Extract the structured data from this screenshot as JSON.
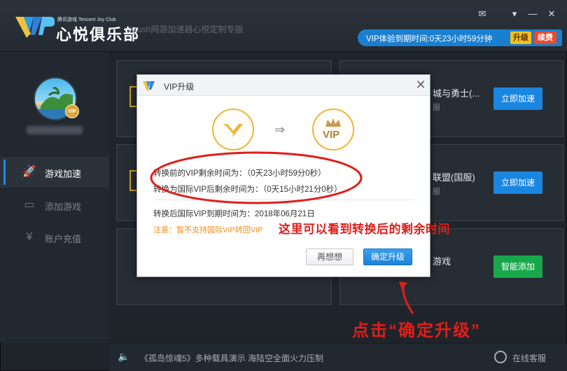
{
  "window": {
    "brand_small": "腾讯游戏 Tencent Joy Club",
    "brand_main": "心悦俱乐部",
    "subtitle": "Xrush网游加速器心悦定制专版",
    "controls": [
      "mail-icon",
      "menu-icon",
      "minimize-icon",
      "close-icon"
    ]
  },
  "vip_bar": {
    "text": "VIP体验到期时间:0天23小时59分钟",
    "upgrade": "升级",
    "renew": "续费"
  },
  "sidebar": {
    "items": [
      {
        "label": "游戏加速",
        "icon": "rocket-icon",
        "active": true
      },
      {
        "label": "添加游戏",
        "icon": "gamepad-icon",
        "active": false
      },
      {
        "label": "账户充值",
        "icon": "yen-icon",
        "active": false
      }
    ]
  },
  "cards": {
    "game1_title": "城与勇士(...",
    "game1_sub": "服",
    "game2_title": "联盟(国服)",
    "game2_sub": "服",
    "game3_title": "游戏",
    "accelerate": "立即加速",
    "smart_add": "智能添加"
  },
  "bottom": {
    "news": "《孤岛惊魂5》多种载具演示 海陆空全面火力压制",
    "service": "在线客服"
  },
  "dialog": {
    "title": "VIP升级",
    "vip_text": "VIP",
    "line1": "转换前的VIP剩余时间为：（0天23小时59分0秒）",
    "line2": "转换为国际VIP后剩余时间为：（0天15小时21分0秒）",
    "line3": "转换后国际VIP到期时间为：2018年06月21日",
    "note": "注意：暂不支持国际VIP转回VIP",
    "reconsider": "再想想",
    "confirm": "确定升级"
  },
  "annotations": {
    "hint1": "这里可以看到转换后的剩余时间",
    "hint2": "点击“确定升级”"
  },
  "colors": {
    "accent_blue": "#1a86e0",
    "vip_gold": "#efb53a",
    "annotation_red": "#e21d18",
    "add_green": "#18a84b"
  }
}
